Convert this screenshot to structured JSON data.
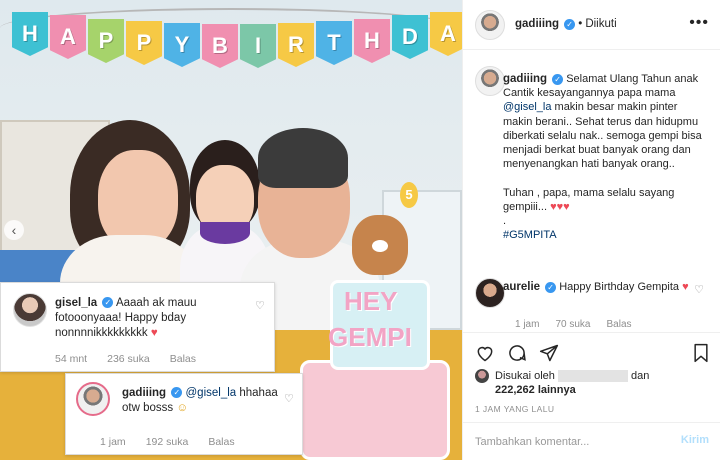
{
  "photo": {
    "banner_letters": [
      "H",
      "A",
      "P",
      "P",
      "Y",
      "B",
      "I",
      "R",
      "T",
      "H",
      "D",
      "A"
    ],
    "banner_colors": [
      "#3ec1d3",
      "#f08fb0",
      "#a6d36b",
      "#f6c945",
      "#4fb3e6",
      "#f08fb0",
      "#7cc7a8",
      "#f6c945",
      "#4fb3e6",
      "#f08fb0",
      "#3ec1d3",
      "#f6c945"
    ],
    "cake_text_top": "HEY",
    "cake_text_bottom": "GEMPI",
    "candle_number": "5"
  },
  "overlay": {
    "comment1": {
      "username": "gisel_la",
      "text": "Aaaah ak mauu fotooonyaaa! Happy bday nonnnnikkkkkkkkk",
      "heart": "♥",
      "time": "54 mnt",
      "likes": "236 suka",
      "reply": "Balas"
    },
    "comment2": {
      "username": "gadiiing",
      "mention": "@gisel_la",
      "text": "hhahaa otw bosss",
      "emoji": "☺",
      "time": "1 jam",
      "likes": "192 suka",
      "reply": "Balas"
    }
  },
  "post": {
    "header": {
      "username": "gadiiing",
      "separator": "•",
      "follow_state": "Diikuti",
      "more": "•••"
    },
    "caption": {
      "username": "gadiiing",
      "line1": "Selamat Ulang Tahun anak Cantik kesayangannya papa mama",
      "mention": "@gisel_la",
      "line2": "makin besar makin pinter makin berani.. Sehat terus dan hidupmu diberkati selalu nak.. semoga gempi bisa menjadi berkat buat banyak orang dan menyenangkan hati banyak orang..",
      "line3": "Tuhan , papa, mama selalu sayang gempiii...",
      "hearts": "♥♥♥",
      "dot": ".",
      "hashtag": "#G5MPITA"
    },
    "comment": {
      "username": "aurelie",
      "text": "Happy Birthday Gempita",
      "heart": "♥",
      "time": "1 jam",
      "likes": "70 suka",
      "reply": "Balas"
    },
    "liked_by_prefix": "Disukai oleh",
    "liked_by_mid": "dan",
    "liked_by_count": "222,262 lainnya",
    "timestamp": "1 JAM YANG LALU",
    "comment_placeholder": "Tambahkan komentar...",
    "send_label": "Kirim"
  }
}
